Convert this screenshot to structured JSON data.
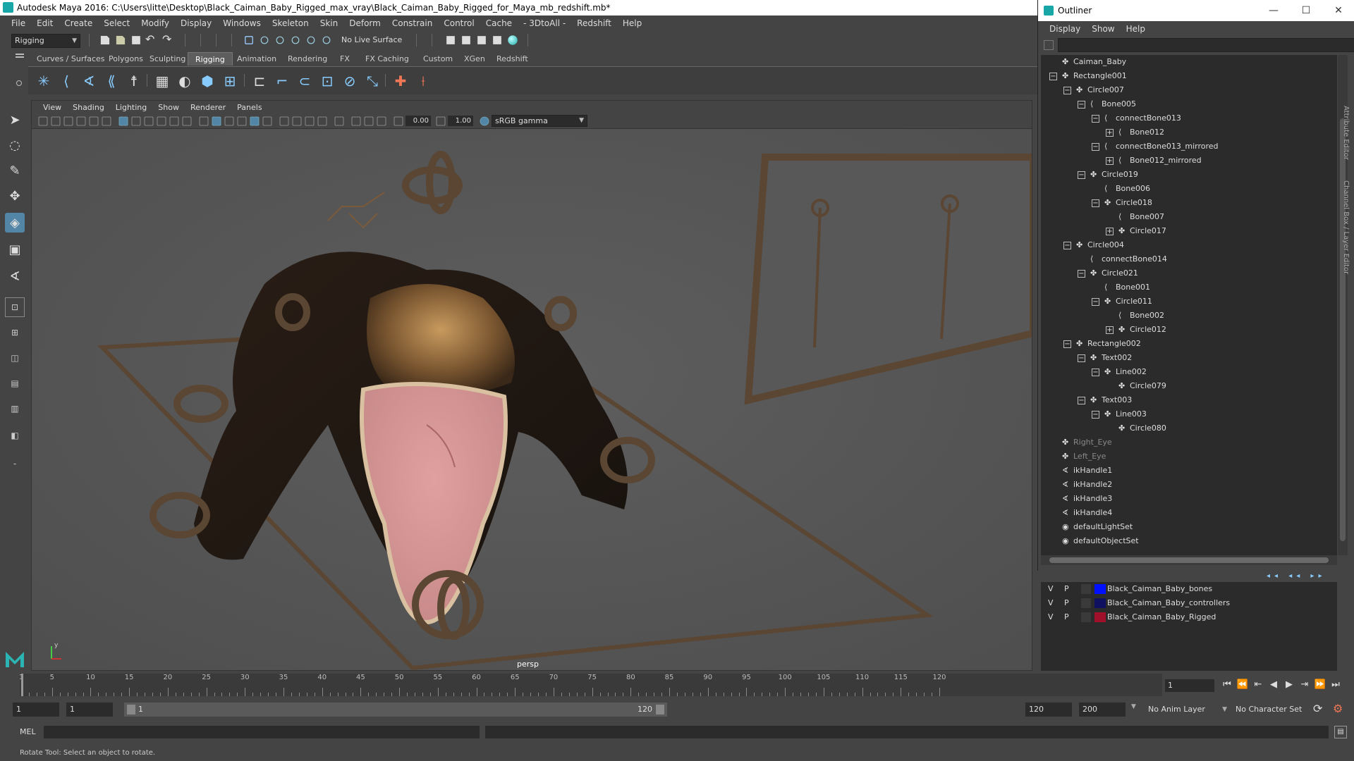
{
  "title_bar": {
    "text": "Autodesk Maya 2016: C:\\Users\\litte\\Desktop\\Black_Caiman_Baby_Rigged_max_vray\\Black_Caiman_Baby_Rigged_for_Maya_mb_redshift.mb*"
  },
  "menus": [
    "File",
    "Edit",
    "Create",
    "Select",
    "Modify",
    "Display",
    "Windows",
    "Skeleton",
    "Skin",
    "Deform",
    "Constrain",
    "Control",
    "Cache",
    "- 3DtoAll -",
    "Redshift",
    "Help"
  ],
  "status_line": {
    "mode": "Rigging",
    "live_surface": "No Live Surface"
  },
  "shelf_tabs": [
    {
      "label": "Curves / Surfaces"
    },
    {
      "label": "Polygons"
    },
    {
      "label": "Sculpting"
    },
    {
      "label": "Rigging",
      "active": true
    },
    {
      "label": "Animation"
    },
    {
      "label": "Rendering"
    },
    {
      "label": "FX"
    },
    {
      "label": "FX Caching"
    },
    {
      "label": "Custom"
    },
    {
      "label": "XGen"
    },
    {
      "label": "Redshift"
    }
  ],
  "viewport": {
    "menus": [
      "View",
      "Shading",
      "Lighting",
      "Show",
      "Renderer",
      "Panels"
    ],
    "field_a": "0.00",
    "field_b": "1.00",
    "color_space": "sRGB gamma",
    "camera_label": "persp",
    "axis_labels": {
      "x": "x",
      "y": "y",
      "z": "z"
    }
  },
  "outliner": {
    "title": "Outliner",
    "menus": [
      "Display",
      "Show",
      "Help"
    ],
    "tree": [
      {
        "label": "Caiman_Baby",
        "depth": 0,
        "icon": "transform",
        "exp": ""
      },
      {
        "label": "Rectangle001",
        "depth": 0,
        "icon": "transform",
        "exp": "-"
      },
      {
        "label": "Circle007",
        "depth": 1,
        "icon": "transform",
        "exp": "-"
      },
      {
        "label": "Bone005",
        "depth": 2,
        "icon": "joint",
        "exp": "-"
      },
      {
        "label": "connectBone013",
        "depth": 3,
        "icon": "joint",
        "exp": "-"
      },
      {
        "label": "Bone012",
        "depth": 4,
        "icon": "joint",
        "exp": "+"
      },
      {
        "label": "connectBone013_mirrored",
        "depth": 3,
        "icon": "joint",
        "exp": "-"
      },
      {
        "label": "Bone012_mirrored",
        "depth": 4,
        "icon": "joint",
        "exp": "+"
      },
      {
        "label": "Circle019",
        "depth": 2,
        "icon": "transform",
        "exp": "-"
      },
      {
        "label": "Bone006",
        "depth": 3,
        "icon": "joint",
        "exp": ""
      },
      {
        "label": "Circle018",
        "depth": 3,
        "icon": "transform",
        "exp": "-"
      },
      {
        "label": "Bone007",
        "depth": 4,
        "icon": "joint",
        "exp": ""
      },
      {
        "label": "Circle017",
        "depth": 4,
        "icon": "transform",
        "exp": "+"
      },
      {
        "label": "Circle004",
        "depth": 1,
        "icon": "transform",
        "exp": "-"
      },
      {
        "label": "connectBone014",
        "depth": 2,
        "icon": "joint",
        "exp": ""
      },
      {
        "label": "Circle021",
        "depth": 2,
        "icon": "transform",
        "exp": "-"
      },
      {
        "label": "Bone001",
        "depth": 3,
        "icon": "joint",
        "exp": ""
      },
      {
        "label": "Circle011",
        "depth": 3,
        "icon": "transform",
        "exp": "-"
      },
      {
        "label": "Bone002",
        "depth": 4,
        "icon": "joint",
        "exp": ""
      },
      {
        "label": "Circle012",
        "depth": 4,
        "icon": "transform",
        "exp": "+"
      },
      {
        "label": "Rectangle002",
        "depth": 1,
        "icon": "transform",
        "exp": "-"
      },
      {
        "label": "Text002",
        "depth": 2,
        "icon": "transform",
        "exp": "-"
      },
      {
        "label": "Line002",
        "depth": 3,
        "icon": "transform",
        "exp": "-"
      },
      {
        "label": "Circle079",
        "depth": 4,
        "icon": "transform",
        "exp": ""
      },
      {
        "label": "Text003",
        "depth": 2,
        "icon": "transform",
        "exp": "-"
      },
      {
        "label": "Line003",
        "depth": 3,
        "icon": "transform",
        "exp": "-"
      },
      {
        "label": "Circle080",
        "depth": 4,
        "icon": "transform",
        "exp": ""
      },
      {
        "label": "Right_Eye",
        "depth": 0,
        "icon": "transform",
        "exp": "",
        "dim": true
      },
      {
        "label": "Left_Eye",
        "depth": 0,
        "icon": "transform",
        "exp": "",
        "dim": true
      },
      {
        "label": "ikHandle1",
        "depth": 0,
        "icon": "ik",
        "exp": ""
      },
      {
        "label": "ikHandle2",
        "depth": 0,
        "icon": "ik",
        "exp": ""
      },
      {
        "label": "ikHandle3",
        "depth": 0,
        "icon": "ik",
        "exp": ""
      },
      {
        "label": "ikHandle4",
        "depth": 0,
        "icon": "ik",
        "exp": ""
      },
      {
        "label": "defaultLightSet",
        "depth": 0,
        "icon": "set",
        "exp": ""
      },
      {
        "label": "defaultObjectSet",
        "depth": 0,
        "icon": "set",
        "exp": ""
      }
    ]
  },
  "layers": [
    {
      "v": "V",
      "p": "P",
      "name": "Black_Caiman_Baby_bones",
      "color": "#0010ff"
    },
    {
      "v": "V",
      "p": "P",
      "name": "Black_Caiman_Baby_controllers",
      "color": "#101060"
    },
    {
      "v": "V",
      "p": "P",
      "name": "Black_Caiman_Baby_Rigged",
      "color": "#a0102a"
    }
  ],
  "time_slider": {
    "ticks": [
      1,
      5,
      10,
      15,
      20,
      25,
      30,
      35,
      40,
      45,
      50,
      55,
      60,
      65,
      70,
      75,
      80,
      85,
      90,
      95,
      100,
      105,
      110,
      115,
      120
    ],
    "current_frame": "1",
    "current_position": 1
  },
  "range": {
    "start": "1",
    "playback_start": "1",
    "range_inner_start": "1",
    "range_inner_end": "120",
    "playback_end": "120",
    "end": "200",
    "anim_layer": "No Anim Layer",
    "character_set": "No Character Set"
  },
  "command_line": {
    "label": "MEL"
  },
  "help_line": {
    "text": "Rotate Tool: Select an object to rotate."
  },
  "side_tabs": [
    "Attribute Editor",
    "Channel Box / Layer Editor"
  ]
}
